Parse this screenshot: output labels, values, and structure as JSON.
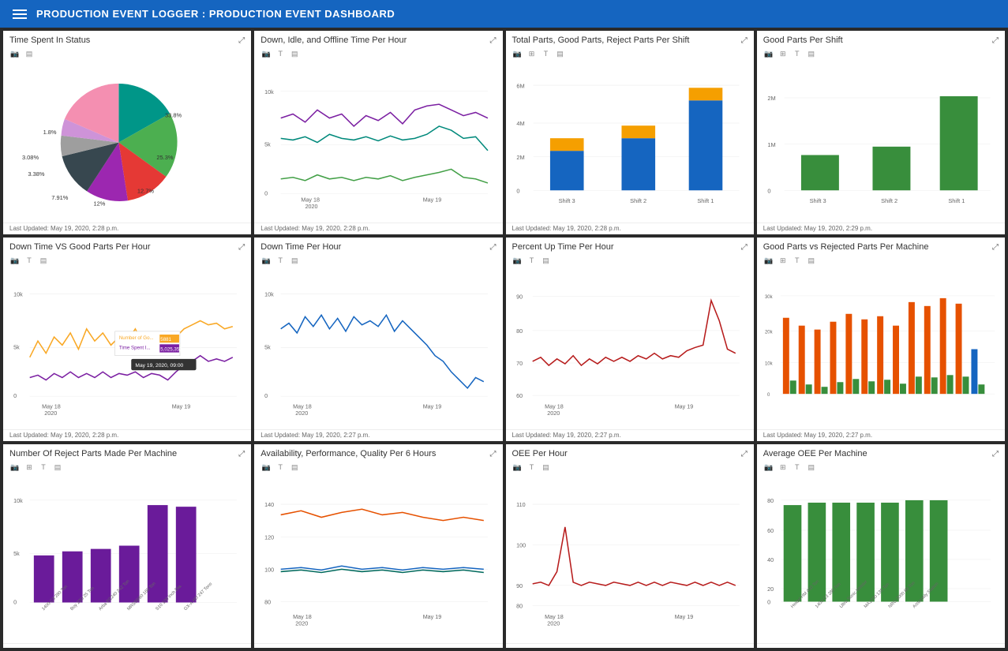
{
  "header": {
    "title": "PRODUCTION EVENT LOGGER : PRODUCTION EVENT DASHBOARD",
    "hamburger_label": "menu"
  },
  "panels": [
    {
      "id": "time-spent-status",
      "title": "Time Spent In Status",
      "footer": "Last Updated: May 19, 2020, 2:28 p.m.",
      "type": "pie"
    },
    {
      "id": "down-idle-offline",
      "title": "Down, Idle, and Offline Time Per Hour",
      "footer": "Last Updated: May 19, 2020, 2:28 p.m.",
      "type": "line-multi"
    },
    {
      "id": "total-parts",
      "title": "Total Parts, Good Parts, Reject Parts Per Shift",
      "footer": "Last Updated: May 19, 2020, 2:28 p.m.",
      "type": "bar-stacked"
    },
    {
      "id": "good-parts-shift",
      "title": "Good Parts Per Shift",
      "footer": "Last Updated: May 19, 2020, 2:29 p.m.",
      "type": "bar-green"
    },
    {
      "id": "downtime-vs-good",
      "title": "Down Time VS Good Parts Per Hour",
      "footer": "Last Updated: May 19, 2020, 2:28 p.m.",
      "type": "line-dual"
    },
    {
      "id": "downtime-per-hour",
      "title": "Down Time Per Hour",
      "footer": "Last Updated: May 19, 2020, 2:27 p.m.",
      "type": "line-blue"
    },
    {
      "id": "percent-up-time",
      "title": "Percent Up Time Per Hour",
      "footer": "Last Updated: May 19, 2020, 2:27 p.m.",
      "type": "line-red"
    },
    {
      "id": "good-vs-rejected",
      "title": "Good Parts vs Rejected Parts Per Machine",
      "footer": "Last Updated: May 19, 2020, 2:27 p.m.",
      "type": "bar-grouped"
    },
    {
      "id": "reject-parts-machine",
      "title": "Number Of Reject Parts Made Per Machine",
      "footer": "",
      "type": "bar-purple"
    },
    {
      "id": "avail-perf-quality",
      "title": "Availability, Performance, Quality Per 6 Hours",
      "footer": "",
      "type": "line-triple"
    },
    {
      "id": "oee-per-hour",
      "title": "OEE Per Hour",
      "footer": "",
      "type": "line-red2"
    },
    {
      "id": "avg-oee-machine",
      "title": "Average OEE Per Machine",
      "footer": "",
      "type": "bar-green2"
    }
  ],
  "colors": {
    "header_bg": "#1565c0",
    "green": "#388e3c",
    "orange": "#e65100",
    "blue": "#1565c0",
    "purple": "#6a1b9a",
    "red": "#b71c1c",
    "yellow": "#f9a825",
    "teal": "#00695c",
    "gold": "#f59f00"
  }
}
